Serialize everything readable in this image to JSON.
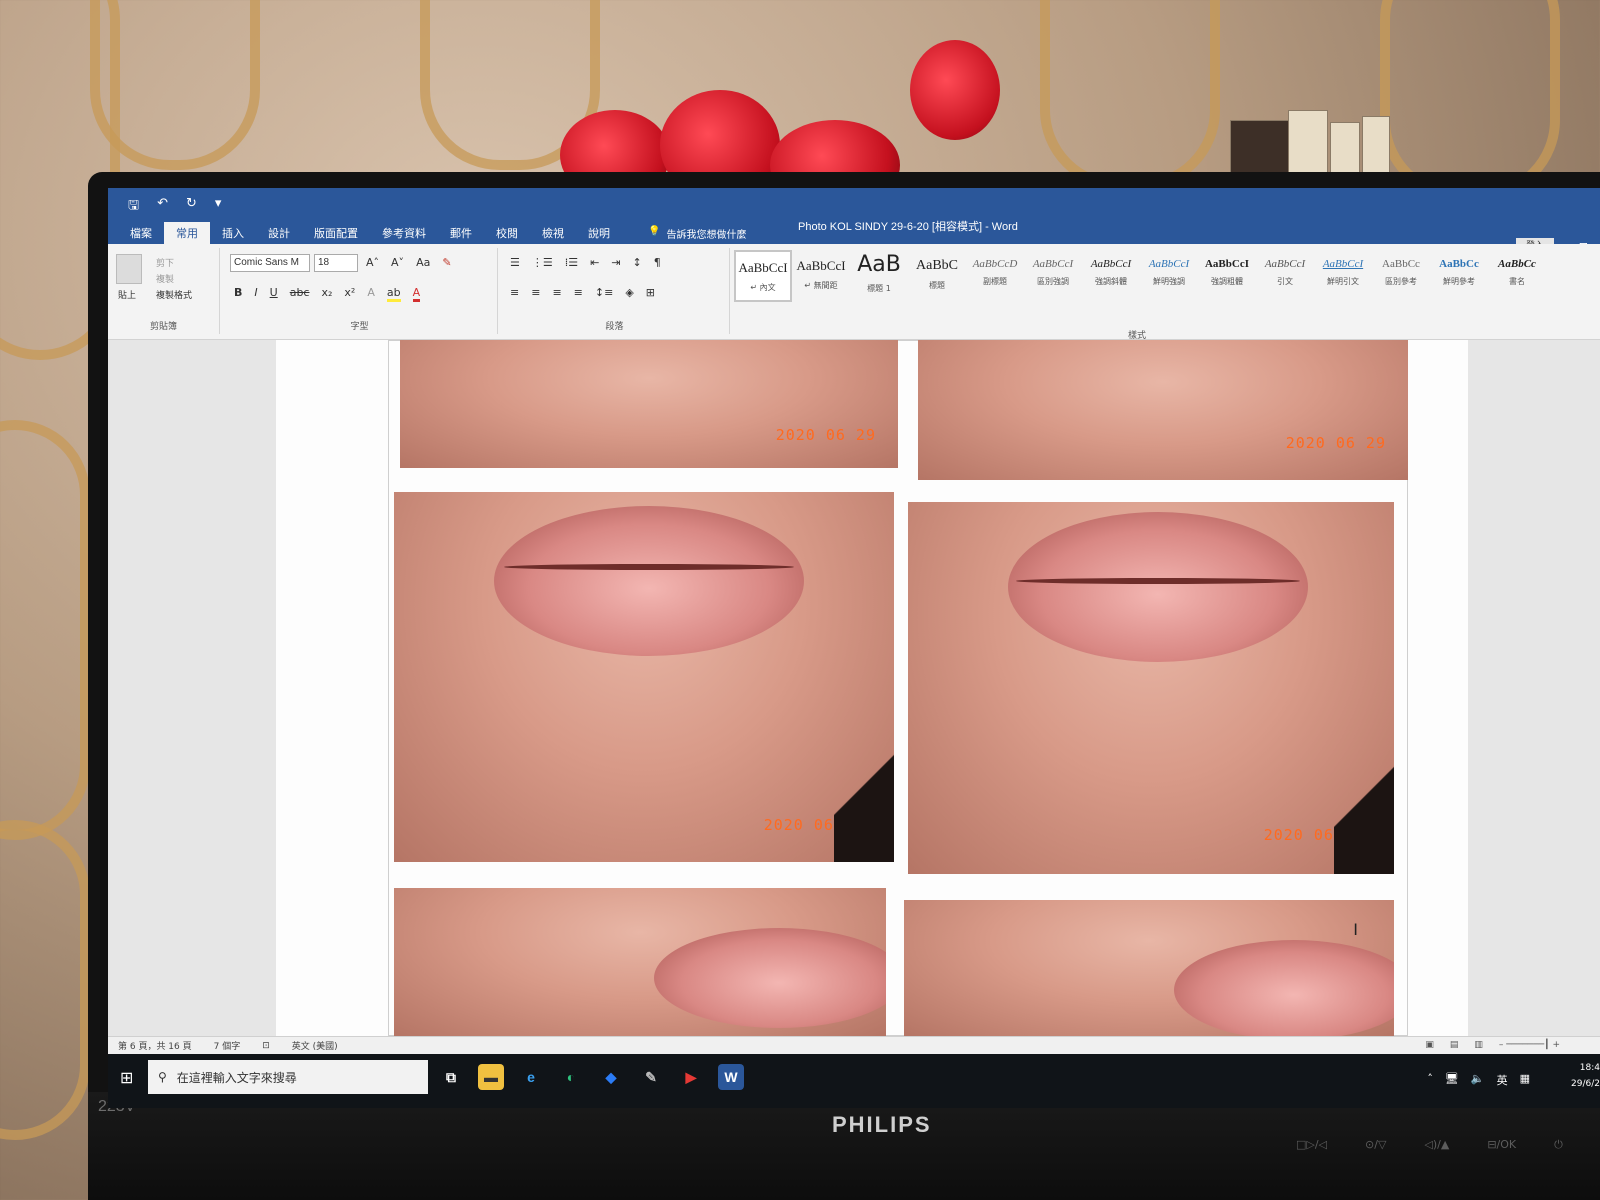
{
  "environment": {
    "monitor_brand": "PHILIPS",
    "monitor_model": "223V",
    "hardware_buttons": [
      "□▷/◁",
      "⊙/▽",
      "◁)/▲",
      "⊟/OK",
      "⏻"
    ]
  },
  "word": {
    "window_title": "Photo KOL SINDY 29-6-20 [相容模式] - Word",
    "login_label": "登入",
    "tabs": [
      "檔案",
      "常用",
      "插入",
      "設計",
      "版面配置",
      "參考資料",
      "郵件",
      "校閱",
      "檢視",
      "說明"
    ],
    "active_tab": "常用",
    "tell_me": "告訴我您想做什麼",
    "clipboard": {
      "paste": "貼上",
      "cut": "剪下",
      "copy": "複製",
      "format_painter": "複製格式",
      "label": "剪貼簿"
    },
    "font": {
      "family": "Comic Sans M",
      "size": "18",
      "label": "字型"
    },
    "paragraph_label": "段落",
    "styles_label": "樣式",
    "styles": [
      {
        "sample": "AaBbCcI",
        "name": "↵ 內文",
        "selected": true
      },
      {
        "sample": "AaBbCcI",
        "name": "↵ 無間距",
        "selected": false
      },
      {
        "sample": "AaB",
        "name": "標題 1",
        "selected": false
      },
      {
        "sample": "AaBbC",
        "name": "標題",
        "selected": false
      },
      {
        "sample": "AaBbCcD",
        "name": "副標題",
        "selected": false
      },
      {
        "sample": "AaBbCcI",
        "name": "區別強調",
        "selected": false
      },
      {
        "sample": "AaBbCcI",
        "name": "強調斜體",
        "selected": false
      },
      {
        "sample": "AaBbCcI",
        "name": "鮮明強調",
        "selected": false
      },
      {
        "sample": "AaBbCcI",
        "name": "強調粗體",
        "selected": false
      },
      {
        "sample": "AaBbCcI",
        "name": "引文",
        "selected": false
      },
      {
        "sample": "AaBbCcI",
        "name": "鮮明引文",
        "selected": false
      },
      {
        "sample": "AaBbCc",
        "name": "區別參考",
        "selected": false
      },
      {
        "sample": "AaBbCc",
        "name": "鮮明參考",
        "selected": false
      },
      {
        "sample": "AaBbCc",
        "name": "書名",
        "selected": false
      }
    ],
    "document": {
      "photo_date_stamp": "2020 06 29"
    },
    "status": {
      "page": "第 6 頁，共 16 頁",
      "words": "7 個字",
      "language": "英文 (美國)"
    }
  },
  "taskbar": {
    "search_placeholder": "在這裡輸入文字來搜尋",
    "tray_lang": "英",
    "time": "18:4",
    "date": "29/6/2"
  }
}
